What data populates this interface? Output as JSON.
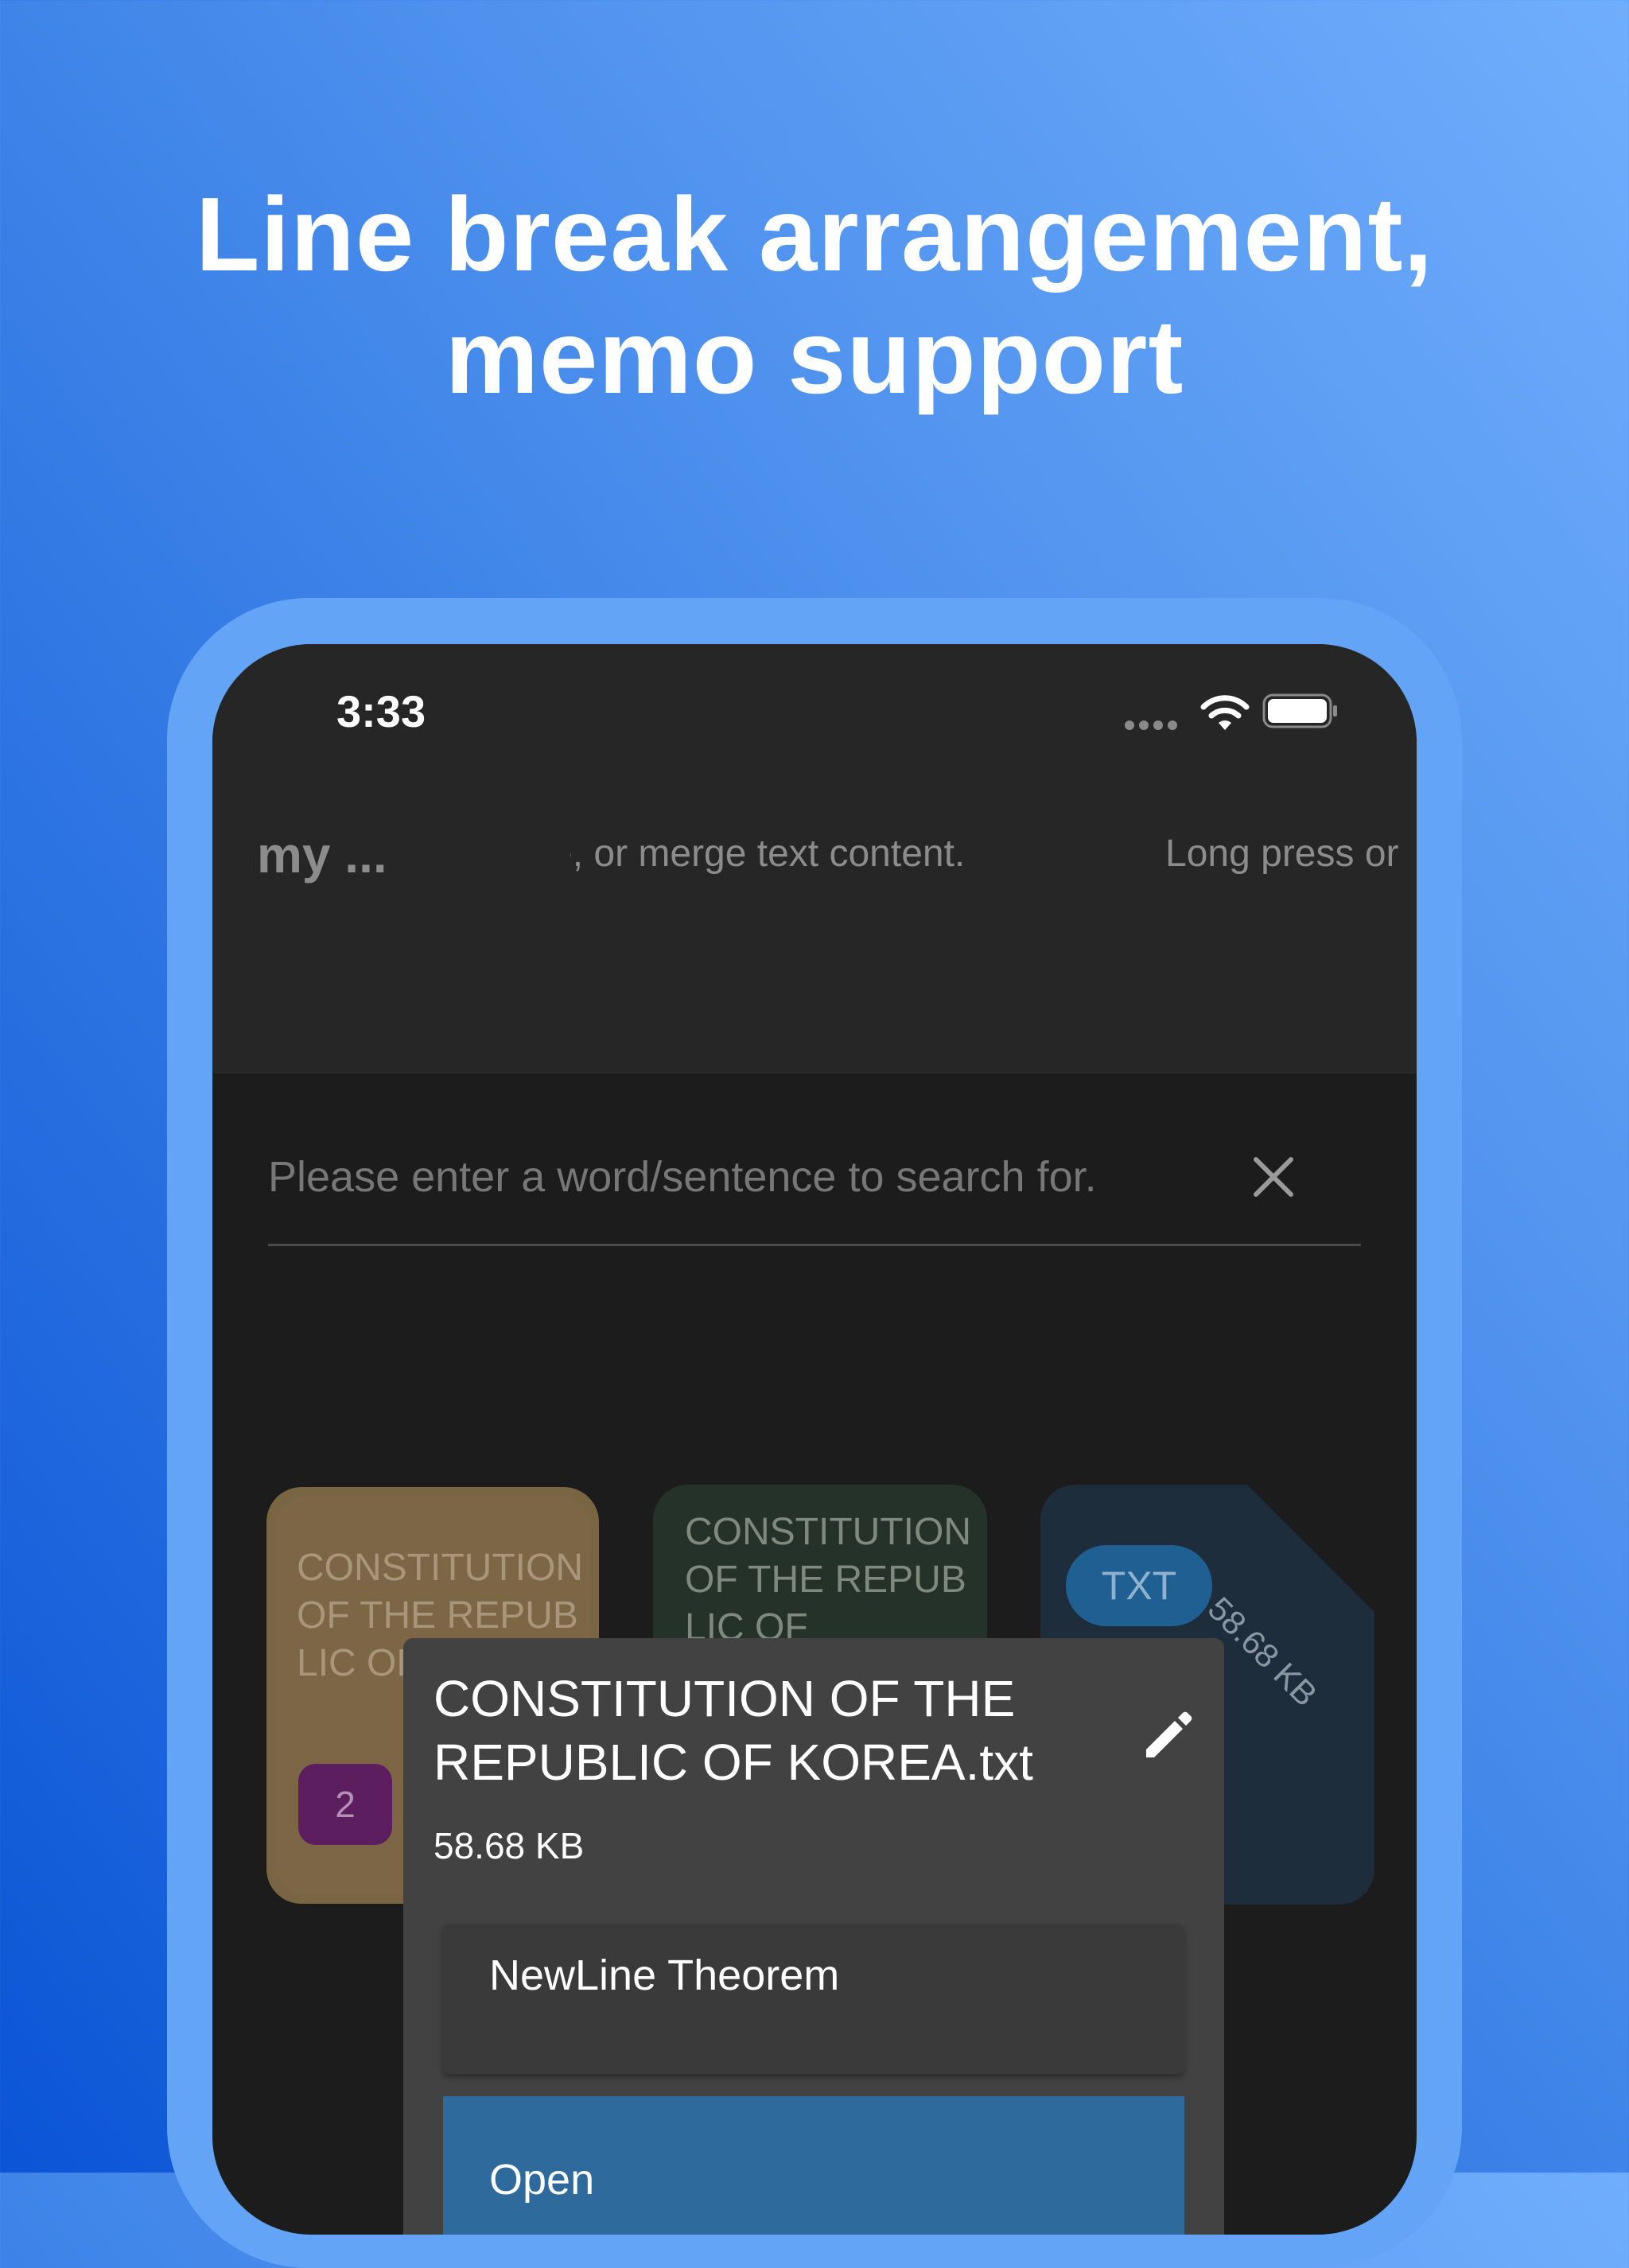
{
  "headline": {
    "line1": "Line break arrangement,",
    "line2": "memo support"
  },
  "status_bar": {
    "time": "3:33"
  },
  "app_bar": {
    "title": "my ...",
    "marquee_1": "e, or merge text content.",
    "marquee_2": "Long press or"
  },
  "search": {
    "placeholder": "Please enter a word/sentence to search for."
  },
  "cards": [
    {
      "title": "CONSTITUTION OF THE REPUBLIC OF KOREA",
      "badge": "2",
      "color": "#7a6543"
    },
    {
      "title": "CONSTITUTION OF THE REPUBLIC OF",
      "color": "#25322a"
    },
    {
      "type_label": "TXT",
      "size": "58.68 KB",
      "color": "#1d2d3b"
    }
  ],
  "popup": {
    "file_name": "CONSTITUTION OF THE REPUBLIC OF KOREA.txt",
    "file_size": "58.68 KB",
    "action_label": "NewLine Theorem",
    "open_label": "Open"
  },
  "colors": {
    "background_top": "#70aefc",
    "background_bottom": "#0a55d6",
    "frame": "#63a4f6",
    "screen": "#1c1c1c",
    "appbar": "#262626",
    "popup": "#424242",
    "open_button": "#2e6a9b"
  },
  "icons": {
    "clear": "close-icon",
    "edit": "pencil-icon",
    "wifi": "wifi-icon",
    "battery": "battery-icon",
    "signal": "signal-icon"
  }
}
